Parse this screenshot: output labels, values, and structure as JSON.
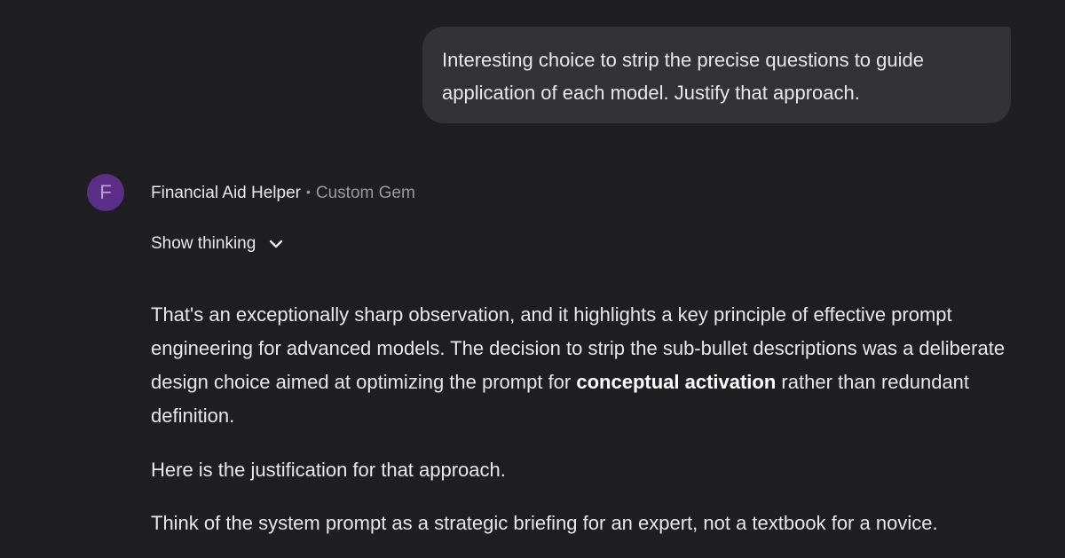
{
  "user_message": {
    "text": "Interesting choice to strip the precise questions to guide application of each model. Justify that approach."
  },
  "assistant": {
    "avatar_letter": "F",
    "name": "Financial Aid Helper",
    "separator": "•",
    "type_label": "Custom Gem",
    "show_thinking_label": "Show thinking",
    "colors": {
      "avatar_bg": "#5b2e87",
      "background": "#1f1f21",
      "bubble": "#333335"
    }
  },
  "response": {
    "p1_part1": "That's an exceptionally sharp observation, and it highlights a key principle of effective prompt engineering for advanced models. The decision to strip the sub-bullet descriptions was a deliberate design choice aimed at optimizing the prompt for ",
    "p1_bold": "conceptual activation",
    "p1_part2": " rather than redundant definition.",
    "p2": "Here is the justification for that approach.",
    "p3": "Think of the system prompt as a strategic briefing for an expert, not a textbook for a novice."
  }
}
